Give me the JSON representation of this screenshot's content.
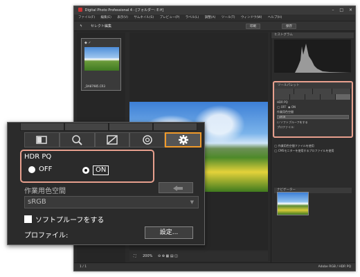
{
  "window": {
    "title": "Digital Photo Professional 4 - [フォルダー: E:¥]",
    "menu": [
      "ファイル(F)",
      "編集(E)",
      "表示(V)",
      "サムネイル(S)",
      "プレビュー(P)",
      "ラベル(L)",
      "調整(A)",
      "ツール(T)",
      "ウィンドウ(W)",
      "ヘルプ(H)"
    ],
    "mode_label": "セレクト編集",
    "toolbar_buttons": [
      "印刷",
      "保存"
    ]
  },
  "thumbnail": {
    "filename": "_DA87985.CR3"
  },
  "right_panel": {
    "histogram_label": "ヒストグラム",
    "tool_palette_label": "ツールパレット",
    "navigator_label": "ナビゲーター",
    "options": [
      "作業用色空間ファイルを使用",
      "CMSモニターを使用するプロファイルを使用"
    ]
  },
  "zoom_panel": {
    "hdr_pq_label": "HDR PQ",
    "off_label": "OFF",
    "on_label": "ON",
    "selected": "ON",
    "working_color_space_label": "作業用色空間",
    "color_space_value": "sRGB",
    "soft_proof_label": "ソフトプルーフをする",
    "profile_label": "プロファイル:",
    "settings_button": "設定..."
  },
  "bottom_toolbar": {
    "zoom_value": "200%"
  },
  "status": {
    "left": "1 / 1",
    "right": "Adobe RGB / HDR PQ"
  },
  "colors": {
    "accent_orange": "#f09a2a",
    "highlight_box": "#e8a08e",
    "window_bg": "#2a2a2a"
  }
}
